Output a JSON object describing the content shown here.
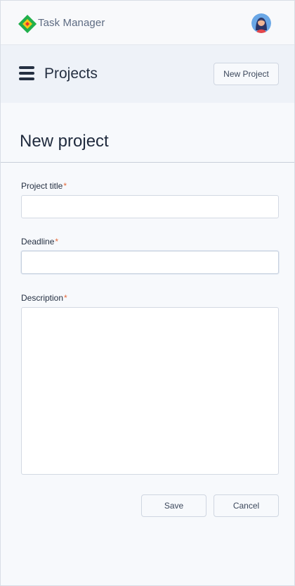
{
  "app": {
    "title": "Task Manager",
    "logo": "diamond-logo-icon",
    "avatar": "user-avatar"
  },
  "header": {
    "menu_icon": "hamburger-menu-icon",
    "title": "Projects",
    "new_button_label": "New Project"
  },
  "form": {
    "title": "New project",
    "fields": [
      {
        "label": "Project title",
        "required_mark": "*",
        "value": "",
        "placeholder": ""
      },
      {
        "label": "Deadline",
        "required_mark": "*",
        "value": "",
        "placeholder": ""
      },
      {
        "label": "Description",
        "required_mark": "*",
        "value": "",
        "placeholder": ""
      }
    ],
    "save_label": "Save",
    "cancel_label": "Cancel"
  },
  "colors": {
    "accent_green": "#1fae4b",
    "accent_yellow": "#f5c518",
    "required_mark": "#e46a3b",
    "text_dark": "#1f2a3d",
    "header_bg": "#eef2f8"
  }
}
